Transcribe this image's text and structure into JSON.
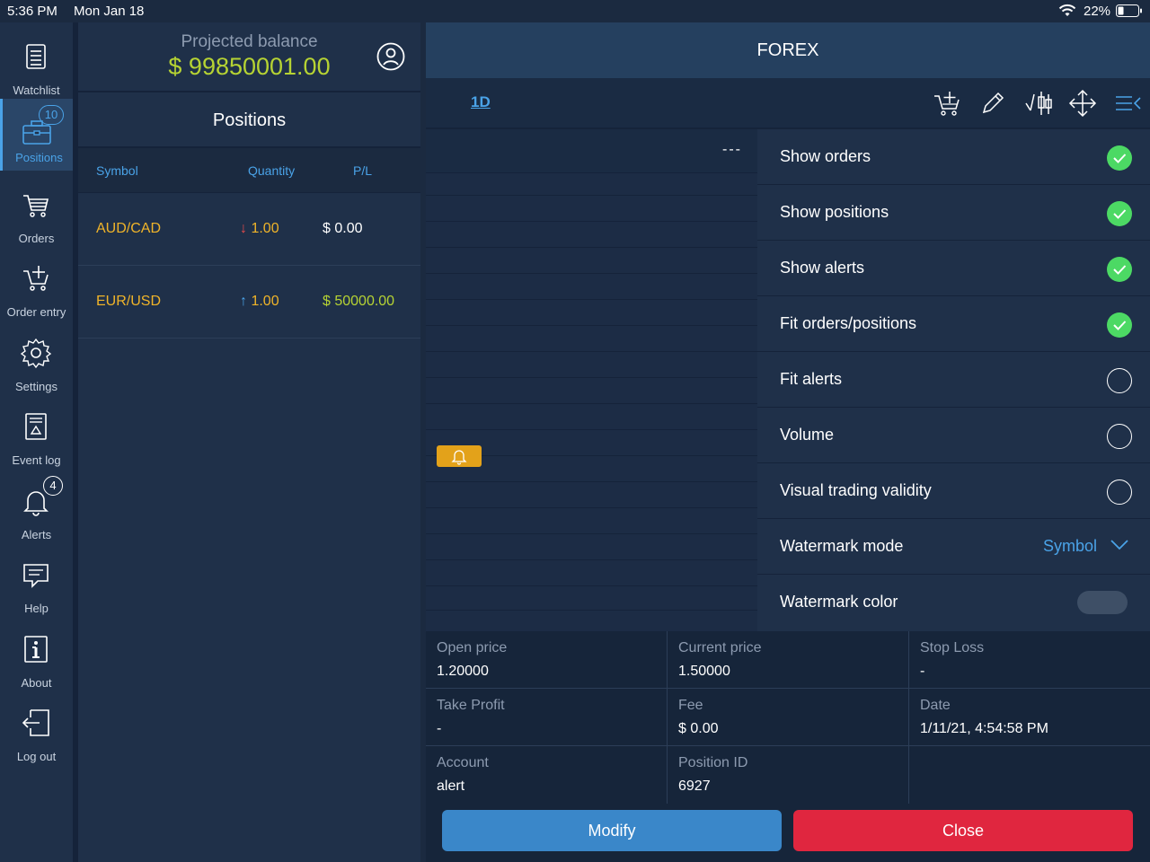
{
  "status": {
    "time": "5:36 PM",
    "date": "Mon Jan 18",
    "battery": "22%"
  },
  "nav": {
    "items": [
      {
        "label": "Watchlist"
      },
      {
        "label": "Positions",
        "badge": "10"
      },
      {
        "label": "Orders"
      },
      {
        "label": "Order entry"
      },
      {
        "label": "Settings"
      },
      {
        "label": "Event log"
      },
      {
        "label": "Alerts",
        "badge": "4"
      },
      {
        "label": "Help"
      },
      {
        "label": "About"
      },
      {
        "label": "Log out"
      }
    ]
  },
  "positions": {
    "balance_label": "Projected balance",
    "balance_value": "$ 99850001.00",
    "title": "Positions",
    "columns": {
      "symbol": "Symbol",
      "quantity": "Quantity",
      "pl": "P/L"
    },
    "rows": [
      {
        "symbol": "AUD/CAD",
        "arrow": "↓",
        "quantity": "1.00",
        "pl": "$ 0.00"
      },
      {
        "symbol": "EUR/USD",
        "arrow": "↑",
        "quantity": "1.00",
        "pl": "$ 50000.00"
      }
    ]
  },
  "chart": {
    "title": "FOREX",
    "timeframe": "1D",
    "price_dash": "---",
    "tools": [
      "cart-add-icon",
      "pencil-icon",
      "candlestick-icon",
      "move-icon",
      "menu-collapse-icon"
    ]
  },
  "settings": {
    "rows": [
      {
        "label": "Show orders",
        "checked": true
      },
      {
        "label": "Show positions",
        "checked": true
      },
      {
        "label": "Show alerts",
        "checked": true
      },
      {
        "label": "Fit orders/positions",
        "checked": true
      },
      {
        "label": "Fit alerts",
        "checked": false
      },
      {
        "label": "Volume",
        "checked": false
      },
      {
        "label": "Visual trading validity",
        "checked": false
      }
    ],
    "watermark_mode": {
      "label": "Watermark mode",
      "value": "Symbol"
    },
    "watermark_color": {
      "label": "Watermark color"
    }
  },
  "details": {
    "open_price": {
      "label": "Open price",
      "value": "1.20000"
    },
    "current_price": {
      "label": "Current price",
      "value": "1.50000"
    },
    "stop_loss": {
      "label": "Stop Loss",
      "value": "-"
    },
    "take_profit": {
      "label": "Take Profit",
      "value": "-"
    },
    "fee": {
      "label": "Fee",
      "value": "$ 0.00"
    },
    "date": {
      "label": "Date",
      "value": "1/11/21, 4:54:58 PM"
    },
    "account": {
      "label": "Account",
      "value": "alert"
    },
    "position_id": {
      "label": "Position ID",
      "value": "6927"
    }
  },
  "actions": {
    "modify": "Modify",
    "close": "Close"
  }
}
